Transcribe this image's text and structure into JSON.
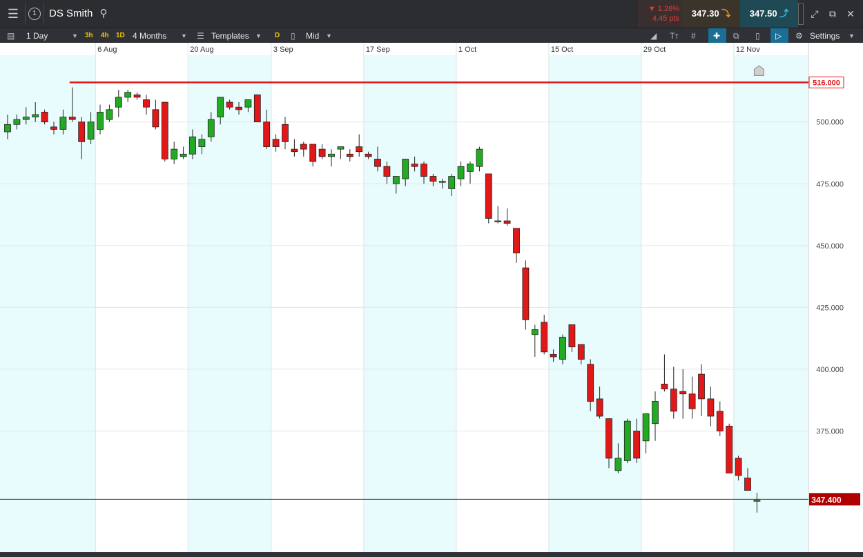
{
  "header": {
    "layout_number": "1",
    "instrument": "DS Smith",
    "change_pct": "1.26%",
    "change_pts": "4.45 pts",
    "sell_price": "347.30",
    "buy_price": "347.50"
  },
  "toolbar": {
    "interval": "1 Day",
    "quick_3h": "3h",
    "quick_4h": "4h",
    "quick_1d": "1D",
    "range": "4 Months",
    "templates": "Templates",
    "type_badge": "D",
    "price_type": "Mid",
    "settings": "Settings"
  },
  "icons": [
    "menu-icon",
    "search-icon",
    "chevron-down-icon",
    "drawing-icon",
    "text-icon",
    "grid-icon",
    "crosshair-icon",
    "copy-icon",
    "candle-icon",
    "price-label-icon",
    "gear-icon",
    "popout-icon",
    "expand-icon"
  ],
  "colors": {
    "up": "#22aa22",
    "down": "#e01818",
    "shade": "#e8fbfd",
    "alert": "#e01818",
    "current_label": "#b00000"
  },
  "chart_data": {
    "type": "candlestick",
    "x_tick_labels": [
      "6 Aug",
      "20 Aug",
      "3 Sep",
      "17 Sep",
      "1 Oct",
      "15 Oct",
      "29 Oct",
      "12 Nov"
    ],
    "y_ticks": [
      "500.000",
      "475.000",
      "450.000",
      "425.000",
      "400.000",
      "375.000"
    ],
    "ylim": [
      326,
      527
    ],
    "alert_line": {
      "value": 516.0,
      "label": "516.000"
    },
    "current_price": {
      "value": 347.4,
      "label": "347.400"
    },
    "ohlc": [
      [
        496,
        503,
        493,
        499
      ],
      [
        499,
        503,
        497,
        501
      ],
      [
        501,
        506,
        499,
        502
      ],
      [
        502,
        508,
        500,
        503
      ],
      [
        504,
        505,
        499,
        500
      ],
      [
        498,
        500,
        495,
        497
      ],
      [
        497,
        505,
        495,
        502
      ],
      [
        502,
        514,
        500,
        501
      ],
      [
        500,
        502,
        485,
        492
      ],
      [
        493,
        504,
        491,
        500
      ],
      [
        497,
        507,
        495,
        504
      ],
      [
        501,
        507,
        500,
        505
      ],
      [
        506,
        513,
        502,
        510
      ],
      [
        510,
        513,
        508,
        512
      ],
      [
        511,
        512,
        509,
        510
      ],
      [
        509,
        511,
        503,
        506
      ],
      [
        505,
        509,
        497,
        498
      ],
      [
        508,
        508,
        484,
        485
      ],
      [
        485,
        492,
        483,
        489
      ],
      [
        486,
        490,
        485,
        487
      ],
      [
        487,
        497,
        485,
        494
      ],
      [
        490,
        495,
        487,
        493
      ],
      [
        494,
        504,
        492,
        501
      ],
      [
        502,
        508,
        499,
        510
      ],
      [
        508,
        509,
        505,
        506
      ],
      [
        506,
        508,
        503,
        505
      ],
      [
        506,
        509,
        504,
        509
      ],
      [
        511,
        511,
        500,
        500
      ],
      [
        500,
        505,
        489,
        490
      ],
      [
        493,
        495,
        488,
        490
      ],
      [
        499,
        502,
        489,
        492
      ],
      [
        489,
        493,
        486,
        488
      ],
      [
        491,
        492,
        486,
        489
      ],
      [
        491,
        491,
        482,
        484
      ],
      [
        489,
        491,
        485,
        486
      ],
      [
        486,
        489,
        482,
        487
      ],
      [
        489,
        490,
        485,
        490
      ],
      [
        487,
        489,
        484,
        486
      ],
      [
        490,
        495,
        486,
        488
      ],
      [
        487,
        488,
        485,
        486
      ],
      [
        485,
        490,
        480,
        482
      ],
      [
        482,
        484,
        475,
        478
      ],
      [
        475,
        477,
        471,
        478
      ],
      [
        477,
        484,
        474,
        485
      ],
      [
        483,
        486,
        480,
        482
      ],
      [
        483,
        484,
        475,
        478
      ],
      [
        478,
        479,
        474,
        476
      ],
      [
        476,
        477,
        473,
        476
      ],
      [
        473,
        479,
        470,
        478
      ],
      [
        477,
        484,
        474,
        482
      ],
      [
        480,
        484,
        475,
        483
      ],
      [
        482,
        490,
        480,
        489
      ],
      [
        479,
        479,
        459,
        461
      ],
      [
        460,
        466,
        459,
        460
      ],
      [
        460,
        465,
        458,
        459
      ],
      [
        457,
        457,
        443,
        447
      ],
      [
        441,
        444,
        416,
        420
      ],
      [
        414,
        418,
        405,
        416
      ],
      [
        419,
        422,
        406,
        407
      ],
      [
        406,
        408,
        403,
        405
      ],
      [
        404,
        414,
        402,
        413
      ],
      [
        418,
        418,
        407,
        409
      ],
      [
        410,
        410,
        402,
        404
      ],
      [
        402,
        404,
        383,
        387
      ],
      [
        388,
        393,
        380,
        381
      ],
      [
        380,
        380,
        360,
        364
      ],
      [
        359,
        370,
        358,
        364
      ],
      [
        363,
        380,
        362,
        379
      ],
      [
        375,
        380,
        362,
        364
      ],
      [
        371,
        375,
        366,
        382
      ],
      [
        378,
        391,
        371,
        387
      ],
      [
        394,
        406,
        391,
        392
      ],
      [
        392,
        401,
        380,
        383
      ],
      [
        391,
        400,
        380,
        390
      ],
      [
        390,
        397,
        380,
        384
      ],
      [
        398,
        402,
        381,
        388
      ],
      [
        388,
        393,
        377,
        381
      ],
      [
        383,
        387,
        373,
        375
      ],
      [
        377,
        378,
        358,
        358
      ],
      [
        364,
        365,
        355,
        357
      ],
      [
        356,
        360,
        351,
        351
      ],
      [
        347,
        350,
        342,
        347
      ]
    ]
  }
}
